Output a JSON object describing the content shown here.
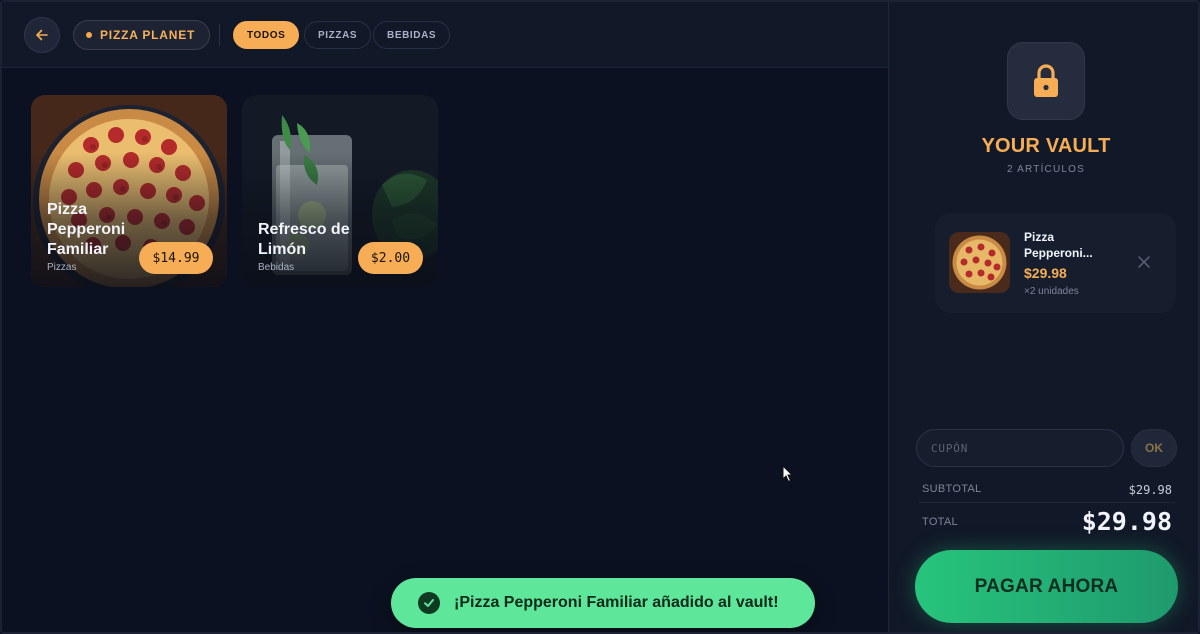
{
  "header": {
    "back_icon": "arrow-left-icon",
    "brand_name": "PIZZA PLANET",
    "tabs": [
      {
        "label": "TODOS",
        "active": true
      },
      {
        "label": "PIZZAS",
        "active": false
      },
      {
        "label": "BEBIDAS",
        "active": false
      }
    ]
  },
  "products": [
    {
      "title": "Pizza Pepperoni Familiar",
      "category": "Pizzas",
      "price": "$14.99"
    },
    {
      "title": "Refresco de Limón",
      "category": "Bebidas",
      "price": "$2.00"
    }
  ],
  "toast": {
    "icon": "check-circle-icon",
    "message": "¡Pizza Pepperoni Familiar añadido al vault!"
  },
  "vault": {
    "icon": "lock-icon",
    "title": "YOUR VAULT",
    "count": "2 ARTÍCULOS",
    "items": [
      {
        "name": "Pizza Pepperoni...",
        "price": "$29.98",
        "quantity": "×2 unidades"
      }
    ],
    "coupon": {
      "placeholder": "CUPÓN",
      "value": "",
      "button_label": "OK"
    },
    "subtotal_label": "SUBTOTAL",
    "subtotal_value": "$29.98",
    "total_label": "TOTAL",
    "total_value": "$29.98",
    "pay_label": "PAGAR AHORA"
  },
  "colors": {
    "accent": "#f6ad55",
    "success": "#5ee69a",
    "pay_button": "#27c47c",
    "background": "#0b1120"
  }
}
